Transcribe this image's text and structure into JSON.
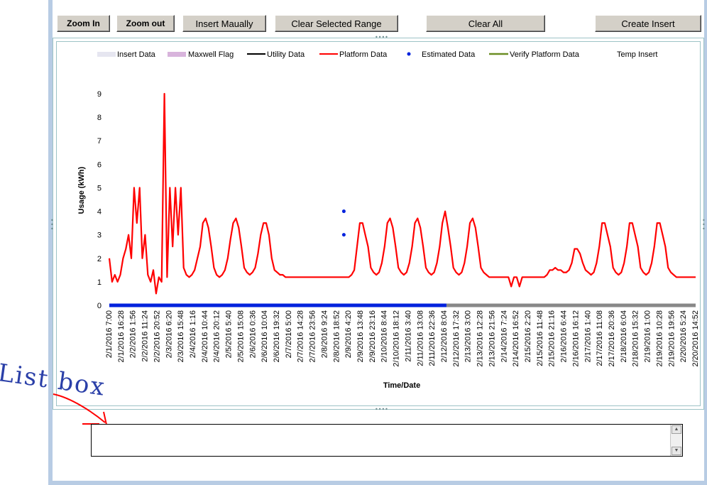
{
  "toolbar": {
    "zoom_in": "Zoom In",
    "zoom_out": "Zoom out",
    "insert_manually": "Insert Maually",
    "clear_selected": "Clear Selected Range",
    "clear_all": "Clear All",
    "create_insert": "Create Insert"
  },
  "legend": {
    "insert_data": "Insert Data",
    "maxwell_flag": "Maxwell Flag",
    "utility_data": "Utility Data",
    "platform_data": "Platform Data",
    "estimated_data": "Estimated Data",
    "verify_platform_data": "Verify Platform Data",
    "temp_insert": "Temp Insert"
  },
  "colors": {
    "insert_data": "#e6e6f0",
    "maxwell_flag": "#d8b4dc",
    "utility_data": "#000000",
    "platform_data": "#ff0000",
    "estimated_data": "#0022dd",
    "verify_platform_data": "#6b8e23",
    "axis_grey": "#888888"
  },
  "annotation": "List box",
  "chart_data": {
    "type": "line",
    "ylabel": "Usage (kWh)",
    "xlabel": "Time/Date",
    "ylim": [
      0,
      9
    ],
    "yticks": [
      0,
      1,
      2,
      3,
      4,
      5,
      6,
      7,
      8,
      9
    ],
    "grid": false,
    "legend_position": "top",
    "x_tick_labels": [
      "2/1/2016 7:00",
      "2/1/2016 16:28",
      "2/2/2016 1:56",
      "2/2/2016 11:24",
      "2/2/2016 20:52",
      "2/3/2016 6:20",
      "2/3/2016 15:48",
      "2/4/2016 1:16",
      "2/4/2016 10:44",
      "2/4/2016 20:12",
      "2/5/2016 5:40",
      "2/5/2016 15:08",
      "2/6/2016 0:36",
      "2/6/2016 10:04",
      "2/6/2016 19:32",
      "2/7/2016 5:00",
      "2/7/2016 14:28",
      "2/7/2016 23:56",
      "2/8/2016 9:24",
      "2/8/2016 18:52",
      "2/9/2016 4:20",
      "2/9/2016 13:48",
      "2/9/2016 23:16",
      "2/10/2016 8:44",
      "2/10/2016 18:12",
      "2/11/2016 3:40",
      "2/11/2016 13:08",
      "2/11/2016 22:36",
      "2/12/2016 8:04",
      "2/12/2016 17:32",
      "2/13/2016 3:00",
      "2/13/2016 12:28",
      "2/13/2016 21:56",
      "2/14/2016 7:24",
      "2/14/2016 16:52",
      "2/15/2016 2:20",
      "2/15/2016 11:48",
      "2/15/2016 21:16",
      "2/16/2016 6:44",
      "2/16/2016 16:12",
      "2/17/2016 1:40",
      "2/17/2016 11:08",
      "2/17/2016 20:36",
      "2/18/2016 6:04",
      "2/18/2016 15:32",
      "2/19/2016 1:00",
      "2/19/2016 10:28",
      "2/19/2016 19:56",
      "2/20/2016 5:24",
      "2/20/2016 14:52"
    ],
    "series": [
      {
        "name": "Platform Data",
        "values": [
          2,
          1,
          1.3,
          1,
          1.3,
          2,
          2.4,
          3,
          2,
          5,
          3.5,
          5,
          2,
          3,
          1.3,
          1,
          1.5,
          0.5,
          1.2,
          1,
          9,
          1.2,
          5,
          2.5,
          5,
          3,
          5,
          1.6,
          1.3,
          1.2,
          1.3,
          1.5,
          2,
          2.5,
          3.5,
          3.7,
          3.3,
          2.5,
          1.6,
          1.3,
          1.2,
          1.3,
          1.5,
          2,
          2.8,
          3.5,
          3.7,
          3.3,
          2.5,
          1.6,
          1.4,
          1.3,
          1.4,
          1.6,
          2.2,
          3,
          3.5,
          3.5,
          3,
          2,
          1.5,
          1.4,
          1.3,
          1.3,
          1.2,
          1.2,
          1.2,
          1.2,
          1.2,
          1.2,
          1.2,
          1.2,
          1.2,
          1.2,
          1.2,
          1.2,
          1.2,
          1.2,
          1.2,
          1.2,
          1.2,
          1.2,
          1.2,
          1.2,
          1.2,
          1.2,
          1.2,
          1.2,
          1.3,
          1.5,
          2.5,
          3.5,
          3.5,
          3,
          2.5,
          1.6,
          1.4,
          1.3,
          1.4,
          1.8,
          2.5,
          3.5,
          3.7,
          3.3,
          2.5,
          1.6,
          1.4,
          1.3,
          1.4,
          1.8,
          2.5,
          3.5,
          3.7,
          3.3,
          2.5,
          1.6,
          1.4,
          1.3,
          1.4,
          1.8,
          2.5,
          3.5,
          4,
          3.3,
          2.5,
          1.6,
          1.4,
          1.3,
          1.4,
          1.8,
          2.5,
          3.5,
          3.7,
          3.3,
          2.5,
          1.6,
          1.4,
          1.3,
          1.2,
          1.2,
          1.2,
          1.2,
          1.2,
          1.2,
          1.2,
          1.2,
          0.8,
          1.2,
          1.2,
          0.8,
          1.2,
          1.2,
          1.2,
          1.2,
          1.2,
          1.2,
          1.2,
          1.2,
          1.2,
          1.3,
          1.5,
          1.5,
          1.6,
          1.5,
          1.5,
          1.4,
          1.4,
          1.5,
          1.8,
          2.4,
          2.4,
          2.2,
          1.8,
          1.5,
          1.4,
          1.3,
          1.4,
          1.8,
          2.5,
          3.5,
          3.5,
          3,
          2.5,
          1.6,
          1.4,
          1.3,
          1.4,
          1.8,
          2.5,
          3.5,
          3.5,
          3,
          2.5,
          1.6,
          1.4,
          1.3,
          1.4,
          1.8,
          2.5,
          3.5,
          3.5,
          3,
          2.5,
          1.6,
          1.4,
          1.3,
          1.2,
          1.2,
          1.2,
          1.2,
          1.2,
          1.2,
          1.2,
          1.2
        ]
      },
      {
        "name": "Estimated Data",
        "points": [
          {
            "x": 0.4,
            "y": 4
          },
          {
            "x": 0.4,
            "y": 3
          }
        ],
        "baseline": {
          "y": 0,
          "x_from": 0,
          "x_to": 0.575
        }
      }
    ]
  }
}
